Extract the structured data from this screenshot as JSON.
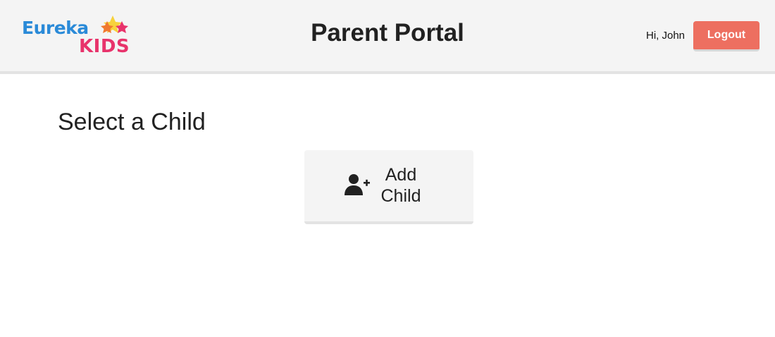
{
  "brand": {
    "logo_top": "Eureka",
    "logo_bottom": "KIDS",
    "colors": {
      "blue": "#2a8ad8",
      "pink": "#e8336b",
      "star_yellow": "#f7d23c",
      "star_orange": "#f0792f",
      "star_red": "#e8336b"
    }
  },
  "header": {
    "title": "Parent Portal",
    "greeting": "Hi, John",
    "logout_label": "Logout",
    "logout_color": "#ed6f60"
  },
  "main": {
    "section_title": "Select a Child",
    "add_child": {
      "label": "Add Child",
      "icon": "user-plus-icon"
    }
  }
}
